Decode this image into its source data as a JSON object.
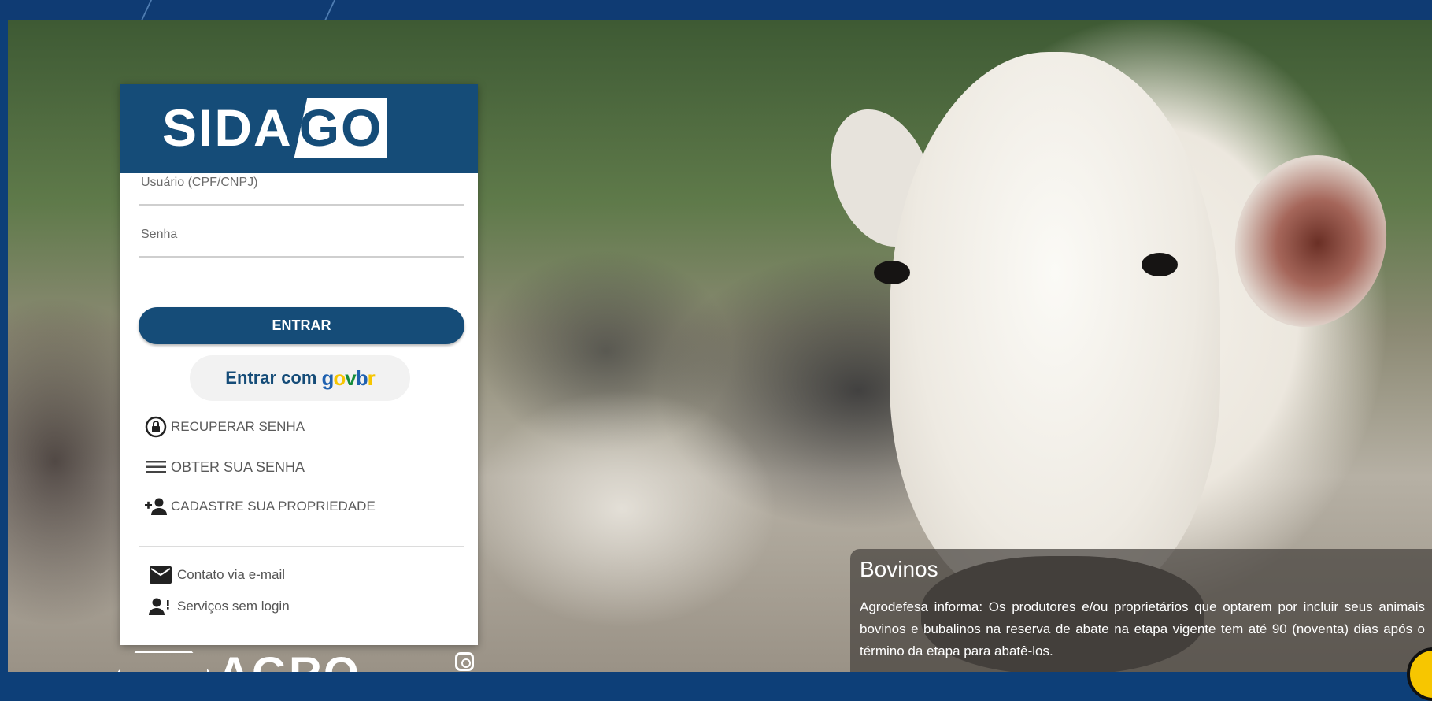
{
  "login": {
    "logo_left": "SIDA",
    "logo_right": "GO",
    "user_placeholder": "Usuário (CPF/CNPJ)",
    "password_placeholder": "Senha",
    "submit_label": "ENTRAR",
    "gov_prefix": "Entrar com",
    "gov_logo": {
      "g": "g",
      "o": "o",
      "v": "v",
      "b": "b",
      "r": "r"
    },
    "links": [
      {
        "icon": "lock-reset-icon",
        "label": "RECUPERAR SENHA"
      },
      {
        "icon": "menu-lines-icon",
        "label": "OBTER SUA SENHA"
      },
      {
        "icon": "add-user-icon",
        "label": "CADASTRE SUA PROPRIEDADE"
      }
    ],
    "contacts": [
      {
        "icon": "mail-icon",
        "label": "Contato via e-mail"
      },
      {
        "icon": "user-services-icon",
        "label": "Serviços sem login"
      }
    ]
  },
  "footer": {
    "brand_text": "AGRO"
  },
  "news": {
    "title": "Bovinos",
    "body": "Agrodefesa informa: Os produtores e/ou proprietários que optarem por incluir seus animais bovinos e bubalinos na reserva de abate na etapa vigente tem até 90 (noventa) dias após o término da etapa para abatê-los."
  },
  "colors": {
    "brand_blue": "#154c78",
    "top_bar": "#0f3b73",
    "gov_yellow": "#f7c600",
    "gov_green": "#168d3c"
  }
}
